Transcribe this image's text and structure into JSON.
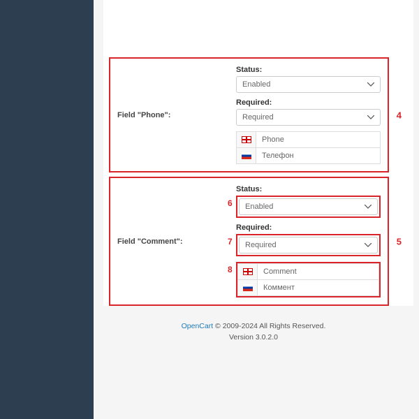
{
  "sections": [
    {
      "label": "Field \"Phone\":",
      "annotation": "4",
      "status": {
        "label": "Status:",
        "value": "Enabled"
      },
      "required": {
        "label": "Required:",
        "value": "Required"
      },
      "translations": [
        {
          "lang": "en",
          "value": "Phone"
        },
        {
          "lang": "ru",
          "value": "Телефон"
        }
      ]
    },
    {
      "label": "Field \"Comment\":",
      "annotation": "5",
      "status": {
        "label": "Status:",
        "value": "Enabled",
        "inner_annotation": "6"
      },
      "required": {
        "label": "Required:",
        "value": "Required",
        "inner_annotation": "7"
      },
      "translations_annotation": "8",
      "translations": [
        {
          "lang": "en",
          "value": "Comment"
        },
        {
          "lang": "ru",
          "value": "Коммент"
        }
      ]
    }
  ],
  "footer": {
    "link": "OpenCart",
    "copyright": " © 2009-2024 All Rights Reserved.",
    "version": "Version 3.0.2.0"
  }
}
